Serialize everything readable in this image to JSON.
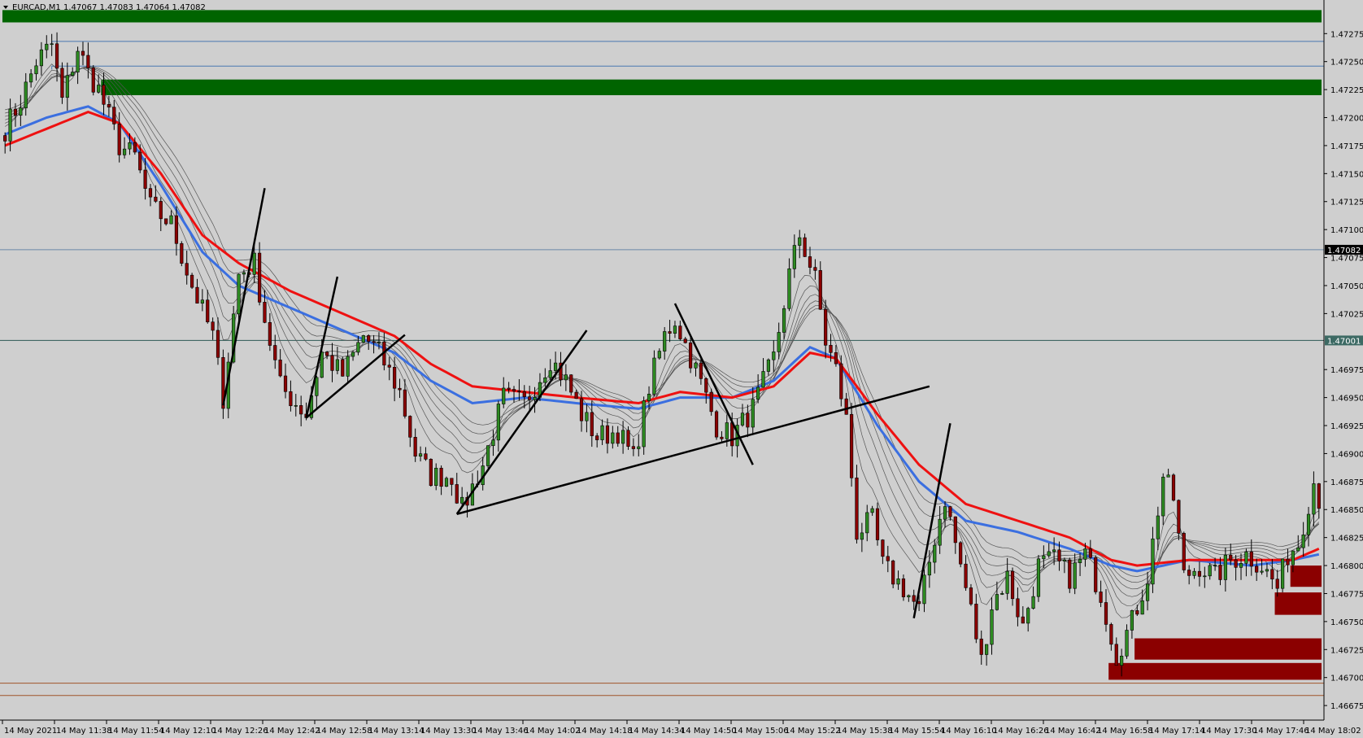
{
  "window": {
    "title": "EURCAD,M1  1.47067  1.47083  1.47064  1.47082",
    "menu_arrow": "down-triangle-icon"
  },
  "chart_data": {
    "type": "candlestick",
    "symbol": "EURCAD",
    "timeframe": "M1",
    "ohlc_header": {
      "open": 1.47067,
      "high": 1.47083,
      "low": 1.47064,
      "close": 1.47082
    },
    "ylim": [
      1.46662,
      1.47305
    ],
    "yticks": [
      "1.47275",
      "1.47250",
      "1.47225",
      "1.47200",
      "1.47175",
      "1.47150",
      "1.47125",
      "1.47100",
      "1.47075",
      "1.47050",
      "1.47025",
      "1.46975",
      "1.46950",
      "1.46925",
      "1.46900",
      "1.46875",
      "1.46850",
      "1.46825",
      "1.46800",
      "1.46775",
      "1.46750",
      "1.46725",
      "1.46700",
      "1.46675"
    ],
    "xticks": [
      "14 May 2021",
      "14 May 11:38",
      "14 May 11:54",
      "14 May 12:10",
      "14 May 12:26",
      "14 May 12:42",
      "14 May 12:58",
      "14 May 13:14",
      "14 May 13:30",
      "14 May 13:46",
      "14 May 14:02",
      "14 May 14:18",
      "14 May 14:34",
      "14 May 14:50",
      "14 May 15:06",
      "14 May 15:22",
      "14 May 15:38",
      "14 May 15:54",
      "14 May 16:10",
      "14 May 16:26",
      "14 May 16:42",
      "14 May 16:58",
      "14 May 17:14",
      "14 May 17:30",
      "14 May 17:46",
      "14 May 18:02"
    ],
    "current_price_label": "1.47082",
    "level_label": "1.47001",
    "horizontal_lines": [
      {
        "price": 1.47268,
        "color": "#4a78b0"
      },
      {
        "price": 1.47246,
        "color": "#4a78b0"
      },
      {
        "price": 1.47082,
        "color": "#6a88a8"
      },
      {
        "price": 1.47001,
        "color": "#2e5a55"
      },
      {
        "price": 1.46695,
        "color": "#a0552a"
      },
      {
        "price": 1.46684,
        "color": "#a0552a"
      }
    ],
    "supply_zones_green": [
      {
        "from_index": 0,
        "top": 1.47296,
        "bottom": 1.47285
      },
      {
        "from_index": 19,
        "top": 1.47234,
        "bottom": 1.4722
      }
    ],
    "demand_zones_red": [
      {
        "from_index": 248,
        "top": 1.468,
        "bottom": 1.46781
      },
      {
        "from_index": 245,
        "top": 1.46776,
        "bottom": 1.46756
      },
      {
        "from_index": 218,
        "top": 1.46735,
        "bottom": 1.46716
      },
      {
        "from_index": 213,
        "top": 1.46713,
        "bottom": 1.46698
      }
    ],
    "trend_lines": [
      {
        "i1": 42,
        "p1": 1.46943,
        "i2": 50,
        "p2": 1.47137
      },
      {
        "i1": 58,
        "p1": 1.46932,
        "i2": 64,
        "p2": 1.47058
      },
      {
        "i1": 58,
        "p1": 1.46932,
        "i2": 77,
        "p2": 1.47006
      },
      {
        "i1": 87,
        "p1": 1.46846,
        "i2": 112,
        "p2": 1.4701
      },
      {
        "i1": 87,
        "p1": 1.46846,
        "i2": 178,
        "p2": 1.4696
      },
      {
        "i1": 129,
        "p1": 1.47034,
        "i2": 144,
        "p2": 1.4689
      },
      {
        "i1": 175,
        "p1": 1.46753,
        "i2": 182,
        "p2": 1.46927
      }
    ],
    "price_anchors": [
      [
        0,
        1.4719
      ],
      [
        3,
        1.47215
      ],
      [
        6,
        1.4725
      ],
      [
        9,
        1.47265
      ],
      [
        11,
        1.47215
      ],
      [
        14,
        1.47262
      ],
      [
        16,
        1.4724
      ],
      [
        18,
        1.47225
      ],
      [
        20,
        1.472
      ],
      [
        22,
        1.47175
      ],
      [
        25,
        1.47165
      ],
      [
        28,
        1.4712
      ],
      [
        32,
        1.47105
      ],
      [
        36,
        1.4705
      ],
      [
        40,
        1.47005
      ],
      [
        42,
        1.4695
      ],
      [
        45,
        1.4706
      ],
      [
        48,
        1.4707
      ],
      [
        50,
        1.4702
      ],
      [
        53,
        1.4696
      ],
      [
        56,
        1.46945
      ],
      [
        58,
        1.46935
      ],
      [
        61,
        1.4699
      ],
      [
        65,
        1.4697
      ],
      [
        69,
        1.47005
      ],
      [
        72,
        1.4699
      ],
      [
        76,
        1.46955
      ],
      [
        79,
        1.469
      ],
      [
        82,
        1.4688
      ],
      [
        86,
        1.4688
      ],
      [
        88,
        1.4685
      ],
      [
        92,
        1.4689
      ],
      [
        96,
        1.4695
      ],
      [
        100,
        1.46945
      ],
      [
        105,
        1.46985
      ],
      [
        108,
        1.46965
      ],
      [
        111,
        1.46935
      ],
      [
        114,
        1.46915
      ],
      [
        118,
        1.4692
      ],
      [
        121,
        1.46895
      ],
      [
        124,
        1.4696
      ],
      [
        127,
        1.47005
      ],
      [
        129,
        1.4702
      ],
      [
        133,
        1.46975
      ],
      [
        137,
        1.46925
      ],
      [
        140,
        1.46915
      ],
      [
        144,
        1.4694
      ],
      [
        148,
        1.46985
      ],
      [
        151,
        1.4706
      ],
      [
        153,
        1.47095
      ],
      [
        156,
        1.47055
      ],
      [
        158,
        1.47
      ],
      [
        160,
        1.46975
      ],
      [
        162,
        1.4693
      ],
      [
        164,
        1.4683
      ],
      [
        167,
        1.4684
      ],
      [
        169,
        1.468
      ],
      [
        173,
        1.4678
      ],
      [
        176,
        1.4676
      ],
      [
        179,
        1.46825
      ],
      [
        181,
        1.4686
      ],
      [
        184,
        1.468
      ],
      [
        186,
        1.4676
      ],
      [
        188,
        1.46715
      ],
      [
        190,
        1.46765
      ],
      [
        193,
        1.4679
      ],
      [
        196,
        1.46745
      ],
      [
        199,
        1.468
      ],
      [
        202,
        1.46805
      ],
      [
        205,
        1.4679
      ],
      [
        208,
        1.4681
      ],
      [
        211,
        1.46775
      ],
      [
        214,
        1.4672
      ],
      [
        217,
        1.4675
      ],
      [
        220,
        1.4679
      ],
      [
        223,
        1.4688
      ],
      [
        225,
        1.4686
      ],
      [
        227,
        1.4679
      ],
      [
        230,
        1.468
      ],
      [
        233,
        1.4679
      ],
      [
        236,
        1.46805
      ],
      [
        239,
        1.4681
      ],
      [
        242,
        1.468
      ],
      [
        245,
        1.4678
      ],
      [
        247,
        1.4681
      ],
      [
        249,
        1.4682
      ],
      [
        252,
        1.46875
      ],
      [
        253,
        1.4686
      ]
    ],
    "ema_red_anchors": [
      [
        0,
        1.47175
      ],
      [
        8,
        1.4719
      ],
      [
        16,
        1.47205
      ],
      [
        22,
        1.47195
      ],
      [
        30,
        1.4715
      ],
      [
        38,
        1.47095
      ],
      [
        45,
        1.4707
      ],
      [
        55,
        1.47045
      ],
      [
        65,
        1.47025
      ],
      [
        75,
        1.47005
      ],
      [
        82,
        1.4698
      ],
      [
        90,
        1.4696
      ],
      [
        100,
        1.46955
      ],
      [
        110,
        1.4695
      ],
      [
        122,
        1.46945
      ],
      [
        130,
        1.46955
      ],
      [
        140,
        1.4695
      ],
      [
        148,
        1.4696
      ],
      [
        155,
        1.4699
      ],
      [
        160,
        1.46985
      ],
      [
        168,
        1.46935
      ],
      [
        176,
        1.4689
      ],
      [
        185,
        1.46855
      ],
      [
        195,
        1.4684
      ],
      [
        205,
        1.46825
      ],
      [
        213,
        1.46805
      ],
      [
        218,
        1.468
      ],
      [
        228,
        1.46805
      ],
      [
        240,
        1.46805
      ],
      [
        248,
        1.46805
      ],
      [
        253,
        1.46815
      ]
    ],
    "ema_blue_anchors": [
      [
        0,
        1.47185
      ],
      [
        8,
        1.472
      ],
      [
        16,
        1.4721
      ],
      [
        22,
        1.47195
      ],
      [
        30,
        1.4714
      ],
      [
        38,
        1.4708
      ],
      [
        45,
        1.4705
      ],
      [
        55,
        1.4703
      ],
      [
        65,
        1.4701
      ],
      [
        75,
        1.4699
      ],
      [
        82,
        1.46965
      ],
      [
        90,
        1.46945
      ],
      [
        100,
        1.4695
      ],
      [
        110,
        1.46945
      ],
      [
        122,
        1.4694
      ],
      [
        130,
        1.4695
      ],
      [
        140,
        1.4695
      ],
      [
        148,
        1.46965
      ],
      [
        155,
        1.46995
      ],
      [
        160,
        1.46985
      ],
      [
        168,
        1.46925
      ],
      [
        176,
        1.46875
      ],
      [
        185,
        1.4684
      ],
      [
        195,
        1.4683
      ],
      [
        205,
        1.46815
      ],
      [
        213,
        1.468
      ],
      [
        218,
        1.46795
      ],
      [
        228,
        1.46805
      ],
      [
        240,
        1.468
      ],
      [
        248,
        1.46805
      ],
      [
        253,
        1.4681
      ]
    ]
  }
}
